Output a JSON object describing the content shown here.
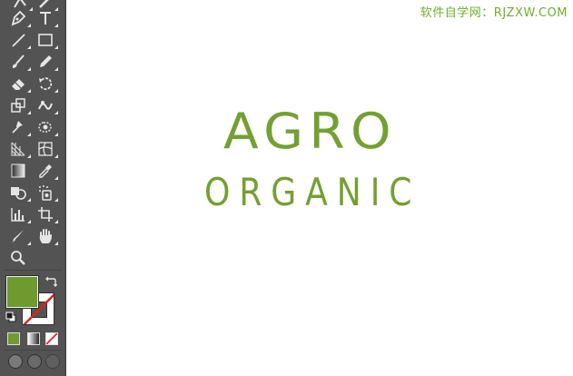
{
  "toolbar": {
    "tools": [
      {
        "name": "selection-tool",
        "icon": "arrow-icon"
      },
      {
        "name": "curvature-tool",
        "icon": "curvature-icon"
      },
      {
        "name": "pen-tool",
        "icon": "pen-icon"
      },
      {
        "name": "type-tool",
        "icon": "type-icon",
        "glyph": "T"
      },
      {
        "name": "line-segment-tool",
        "icon": "line-icon"
      },
      {
        "name": "rectangle-tool",
        "icon": "rectangle-icon"
      },
      {
        "name": "paintbrush-tool",
        "icon": "brush-icon"
      },
      {
        "name": "pencil-tool",
        "icon": "pencil-icon"
      },
      {
        "name": "eraser-tool",
        "icon": "eraser-icon"
      },
      {
        "name": "rotate-tool",
        "icon": "rotate-icon"
      },
      {
        "name": "scale-tool",
        "icon": "scale-icon"
      },
      {
        "name": "warp-tool",
        "icon": "warp-icon"
      },
      {
        "name": "puppet-warp-tool",
        "icon": "pin-icon"
      },
      {
        "name": "free-transform-tool",
        "icon": "free-transform-icon"
      },
      {
        "name": "perspective-grid-tool",
        "icon": "perspective-grid-icon"
      },
      {
        "name": "mesh-tool",
        "icon": "mesh-icon"
      },
      {
        "name": "gradient-tool",
        "icon": "gradient-icon"
      },
      {
        "name": "eyedropper-tool",
        "icon": "eyedropper-icon"
      },
      {
        "name": "shape-builder-tool",
        "icon": "shape-builder-icon"
      },
      {
        "name": "symbol-sprayer-tool",
        "icon": "symbol-sprayer-icon"
      },
      {
        "name": "column-graph-tool",
        "icon": "column-graph-icon"
      },
      {
        "name": "artboard-tool",
        "icon": "artboard-icon"
      },
      {
        "name": "slice-tool",
        "icon": "slice-icon"
      },
      {
        "name": "hand-tool",
        "icon": "hand-icon"
      },
      {
        "name": "zoom-tool",
        "icon": "zoom-icon"
      }
    ],
    "fill_color": "#6e9a2f",
    "stroke_color": "none",
    "panel_color": "#535353"
  },
  "canvas": {
    "watermark": "软件自学网：RJZXW.COM",
    "logo_line1": "AGRO",
    "logo_line2": "ORGANIC",
    "logo_color": "#73a032",
    "background": "#ffffff"
  }
}
